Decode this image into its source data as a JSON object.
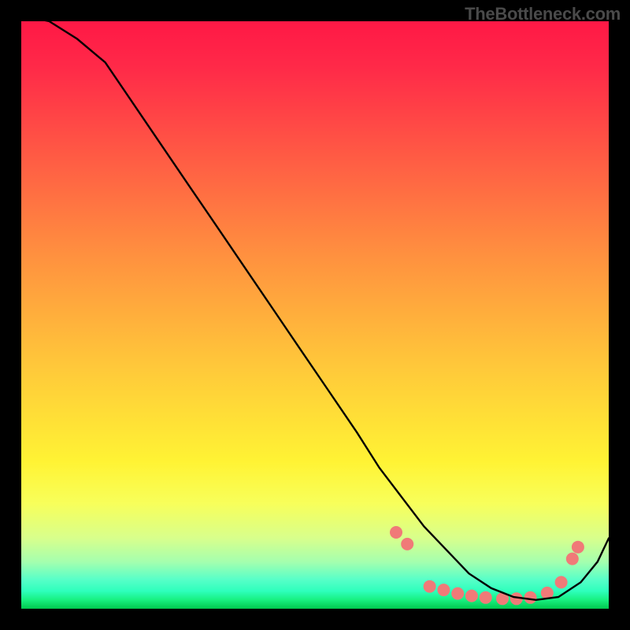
{
  "watermark": "TheBottleneck.com",
  "chart_data": {
    "type": "line",
    "title": "",
    "xlabel": "",
    "ylabel": "",
    "xlim": [
      0,
      100
    ],
    "ylim": [
      0,
      100
    ],
    "grid": false,
    "legend": false,
    "series": [
      {
        "name": "bottleneck-curve",
        "x": [
          0,
          5,
          10,
          15,
          20,
          25,
          30,
          35,
          40,
          45,
          50,
          55,
          60,
          64,
          68,
          72,
          76,
          80,
          84,
          88,
          92,
          96,
          100,
          103,
          105
        ],
        "y": [
          101,
          100,
          97,
          93,
          86,
          79,
          72,
          65,
          58,
          51,
          44,
          37,
          30,
          24,
          19,
          14,
          10,
          6,
          3.5,
          2,
          1.5,
          2,
          4.5,
          8,
          12
        ],
        "stroke": "#000000"
      }
    ],
    "markers": {
      "name": "highlight-dots",
      "x": [
        67,
        69,
        73,
        75.5,
        78,
        80.5,
        83,
        86,
        88.5,
        91,
        94,
        96.5,
        98.5,
        99.5
      ],
      "y": [
        13,
        11,
        3.8,
        3.2,
        2.6,
        2.2,
        1.9,
        1.7,
        1.7,
        1.9,
        2.7,
        4.5,
        8.5,
        10.5
      ],
      "color": "#f07a78",
      "radius": 8
    },
    "gradient_colors": {
      "top": "#ff1846",
      "mid": "#fff334",
      "bottom": "#00c84e"
    }
  }
}
